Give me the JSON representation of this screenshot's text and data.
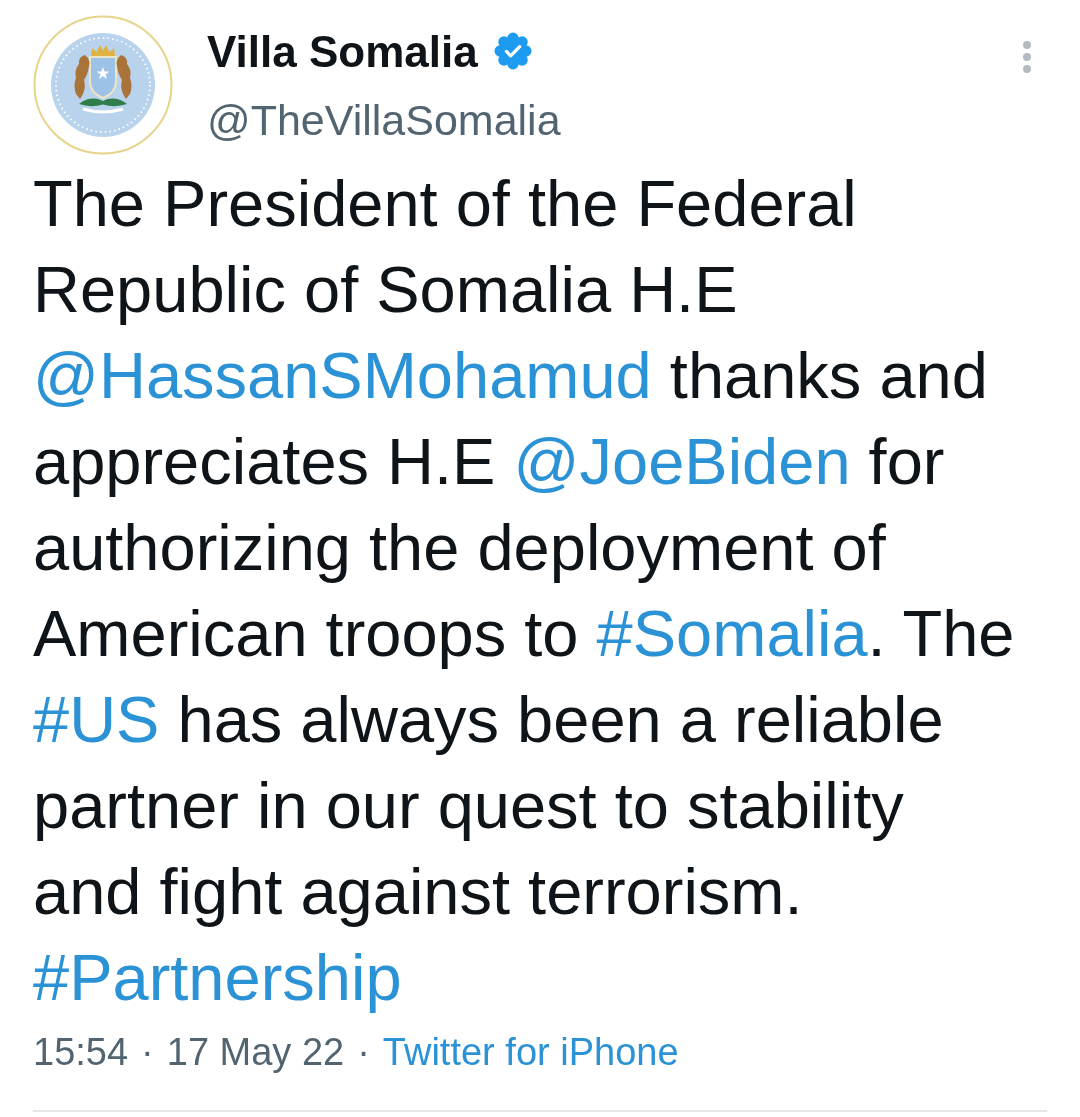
{
  "author": {
    "name": "Villa Somalia",
    "verified": true,
    "handle": "@TheVillaSomalia"
  },
  "tweet": {
    "segments": [
      {
        "kind": "text",
        "text": "The President of the Federal Republic of Somalia H.E "
      },
      {
        "kind": "mention",
        "text": "@HassanSMohamud"
      },
      {
        "kind": "text",
        "text": " thanks and appreciates H.E "
      },
      {
        "kind": "mention",
        "text": "@JoeBiden"
      },
      {
        "kind": "text",
        "text": " for authorizing the deployment of American troops to "
      },
      {
        "kind": "hashtag",
        "text": "#Somalia"
      },
      {
        "kind": "text",
        "text": ". The "
      },
      {
        "kind": "hashtag",
        "text": "#US"
      },
      {
        "kind": "text",
        "text": " has always been a reliable partner in our quest to stability and fight against terrorism. "
      },
      {
        "kind": "hashtag",
        "text": "#Partnership"
      }
    ]
  },
  "meta": [
    {
      "kind": "time",
      "text": "15:54"
    },
    {
      "kind": "separator",
      "text": "·"
    },
    {
      "kind": "date",
      "text": "17 May 22"
    },
    {
      "kind": "separator",
      "text": "·"
    },
    {
      "kind": "source",
      "text": "Twitter for iPhone"
    }
  ]
}
